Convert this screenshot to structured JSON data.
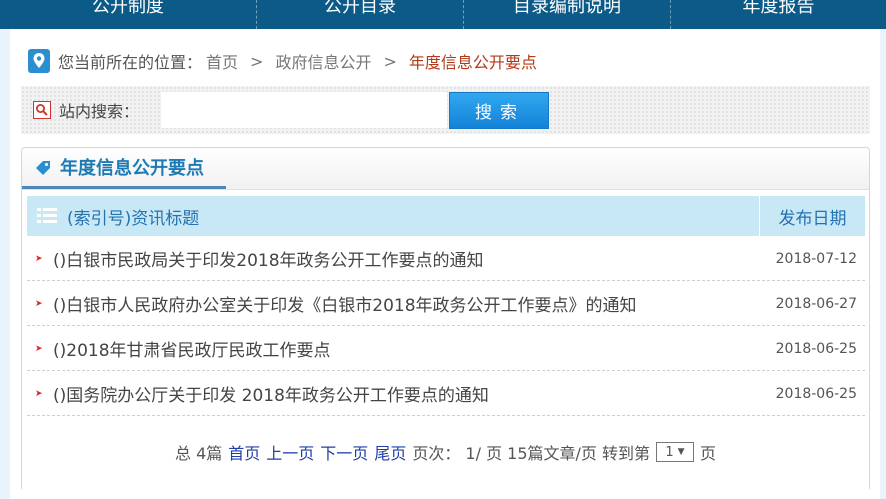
{
  "nav": {
    "items": [
      {
        "label": "公开制度"
      },
      {
        "label": "公开目录"
      },
      {
        "label": "目录编制说明"
      },
      {
        "label": "年度报告"
      }
    ]
  },
  "breadcrumb": {
    "prefix": "您当前所在的位置：",
    "home": "首页",
    "sep1": ">",
    "section": "政府信息公开",
    "sep2": ">",
    "current": "年度信息公开要点"
  },
  "search": {
    "label": "站内搜索：",
    "placeholder": "",
    "value": "",
    "button_label": "搜索"
  },
  "box": {
    "title": "年度信息公开要点"
  },
  "table": {
    "col_title": "(索引号)资讯标题",
    "col_date": "发布日期",
    "rows": [
      {
        "title": "()白银市民政局关于印发2018年政务公开工作要点的通知",
        "date": "2018-07-12"
      },
      {
        "title": "()白银市人民政府办公室关于印发《白银市2018年政务公开工作要点》的通知",
        "date": "2018-06-27"
      },
      {
        "title": "()2018年甘肃省民政厅民政工作要点",
        "date": "2018-06-25"
      },
      {
        "title": "()国务院办公厅关于印发 2018年政务公开工作要点的通知",
        "date": "2018-06-25"
      }
    ]
  },
  "pager": {
    "total": "总 4篇",
    "first": "首页",
    "prev": "上一页",
    "next": "下一页",
    "last": "尾页",
    "page_info": "页次： 1/ 页 15篇文章/页 转到第",
    "selected_page": "1",
    "suffix": "页"
  },
  "colors": {
    "nav_bg": "#0b5a88",
    "accent": "#1d7ab5",
    "table_header_bg": "#c9e8f6",
    "breadcrumb_current": "#b23a17",
    "button_blue": "#1382d8",
    "bullet_red": "#d62b1f",
    "pager_link": "#1f3fa8"
  }
}
